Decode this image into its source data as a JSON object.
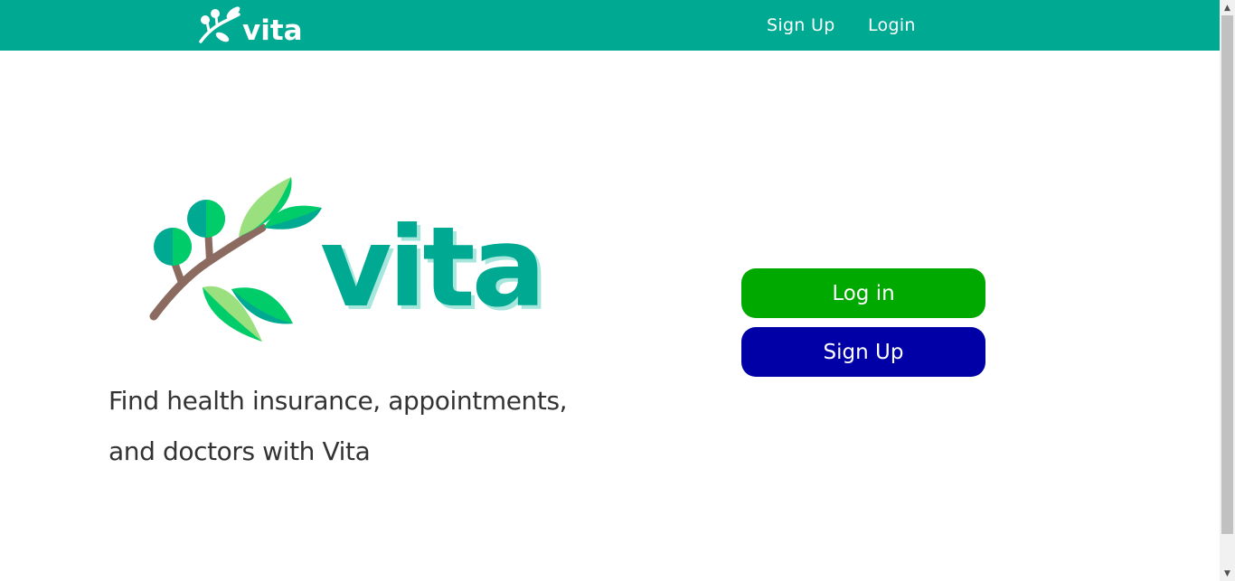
{
  "brand": {
    "name": "vita",
    "colors": {
      "primary": "#00a992",
      "leaf_light": "#9be07e",
      "leaf_mid": "#00cc6a",
      "leaf_dark": "#00a992",
      "branch": "#8b6b60",
      "text_shadow": "#a7e6dc"
    }
  },
  "nav": {
    "signup_label": "Sign Up",
    "login_label": "Login"
  },
  "hero": {
    "tagline_line1": "Find health insurance, appointments,",
    "tagline_line2": "and doctors with Vita"
  },
  "actions": {
    "login_label": "Log in",
    "signup_label": "Sign Up",
    "login_color": "#00a900",
    "signup_color": "#0000a6"
  },
  "scrollbar": {
    "up_icon": "triangle-up-icon",
    "down_icon": "triangle-down-icon"
  }
}
